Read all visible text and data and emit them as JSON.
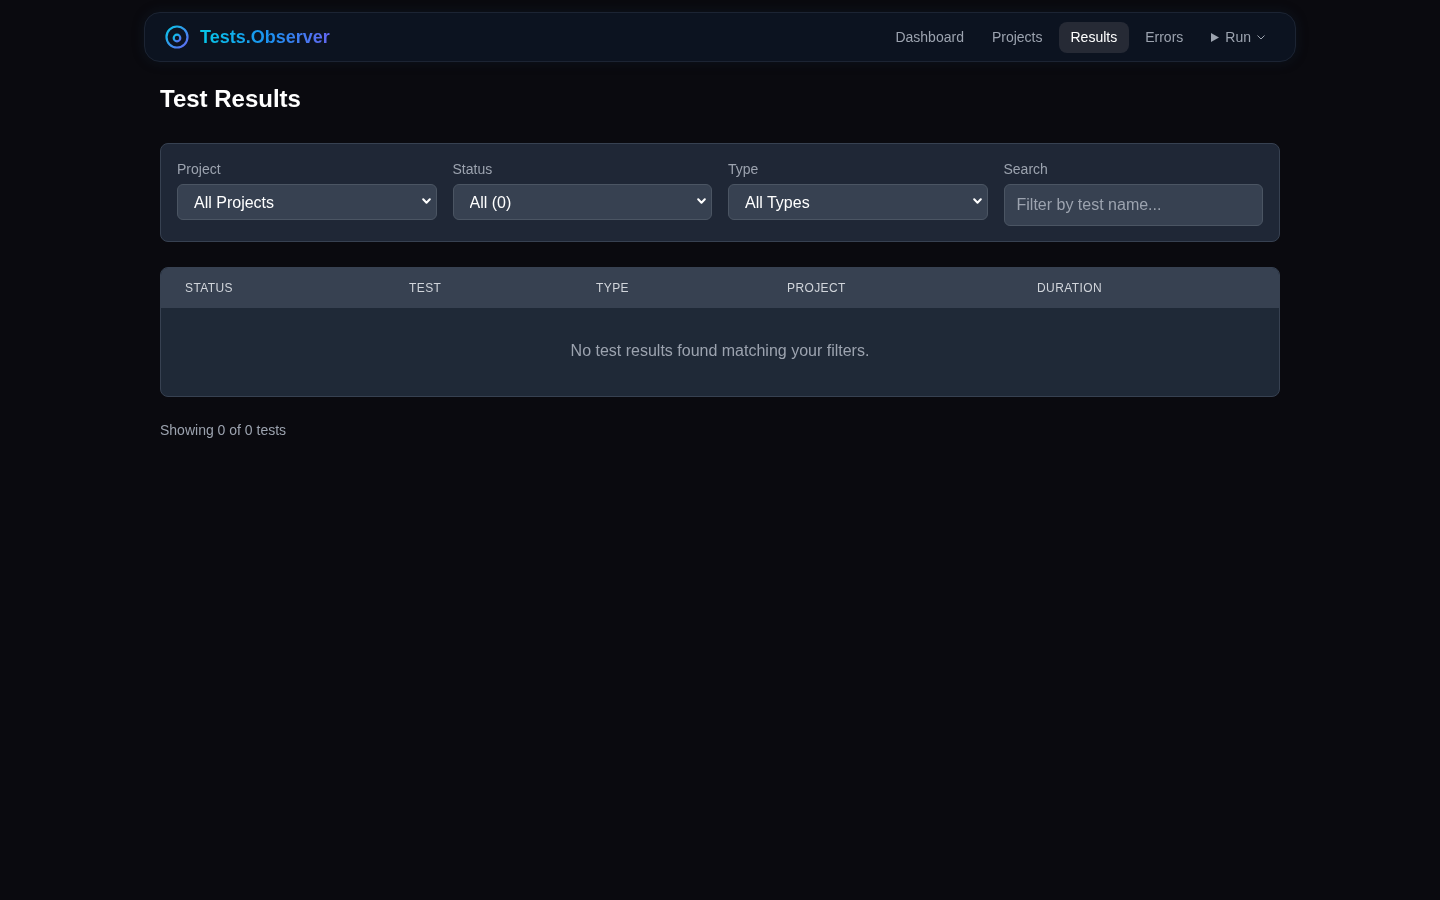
{
  "nav": {
    "brand": "Tests.Observer",
    "links": [
      {
        "label": "Dashboard",
        "kind": "link",
        "selected": false
      },
      {
        "label": "Projects",
        "kind": "link",
        "selected": false
      },
      {
        "label": "Results",
        "kind": "link",
        "selected": true
      },
      {
        "label": "Errors",
        "kind": "link",
        "selected": false
      },
      {
        "label": "Run",
        "kind": "menu",
        "selected": false
      }
    ]
  },
  "page": {
    "title": "Test Results"
  },
  "filters": [
    {
      "label": "Project",
      "kind": "select",
      "value": "All Projects"
    },
    {
      "label": "Status",
      "kind": "select",
      "value": "All (0)"
    },
    {
      "label": "Type",
      "kind": "select",
      "value": "All Types"
    },
    {
      "label": "Search",
      "kind": "search",
      "placeholder": "Filter by test name..."
    }
  ],
  "table": {
    "columns": [
      "STATUS",
      "TEST",
      "TYPE",
      "PROJECT",
      "DURATION"
    ],
    "empty_message": "No test results found matching your filters."
  },
  "footer": {
    "summary": "Showing 0 of 0 tests"
  }
}
